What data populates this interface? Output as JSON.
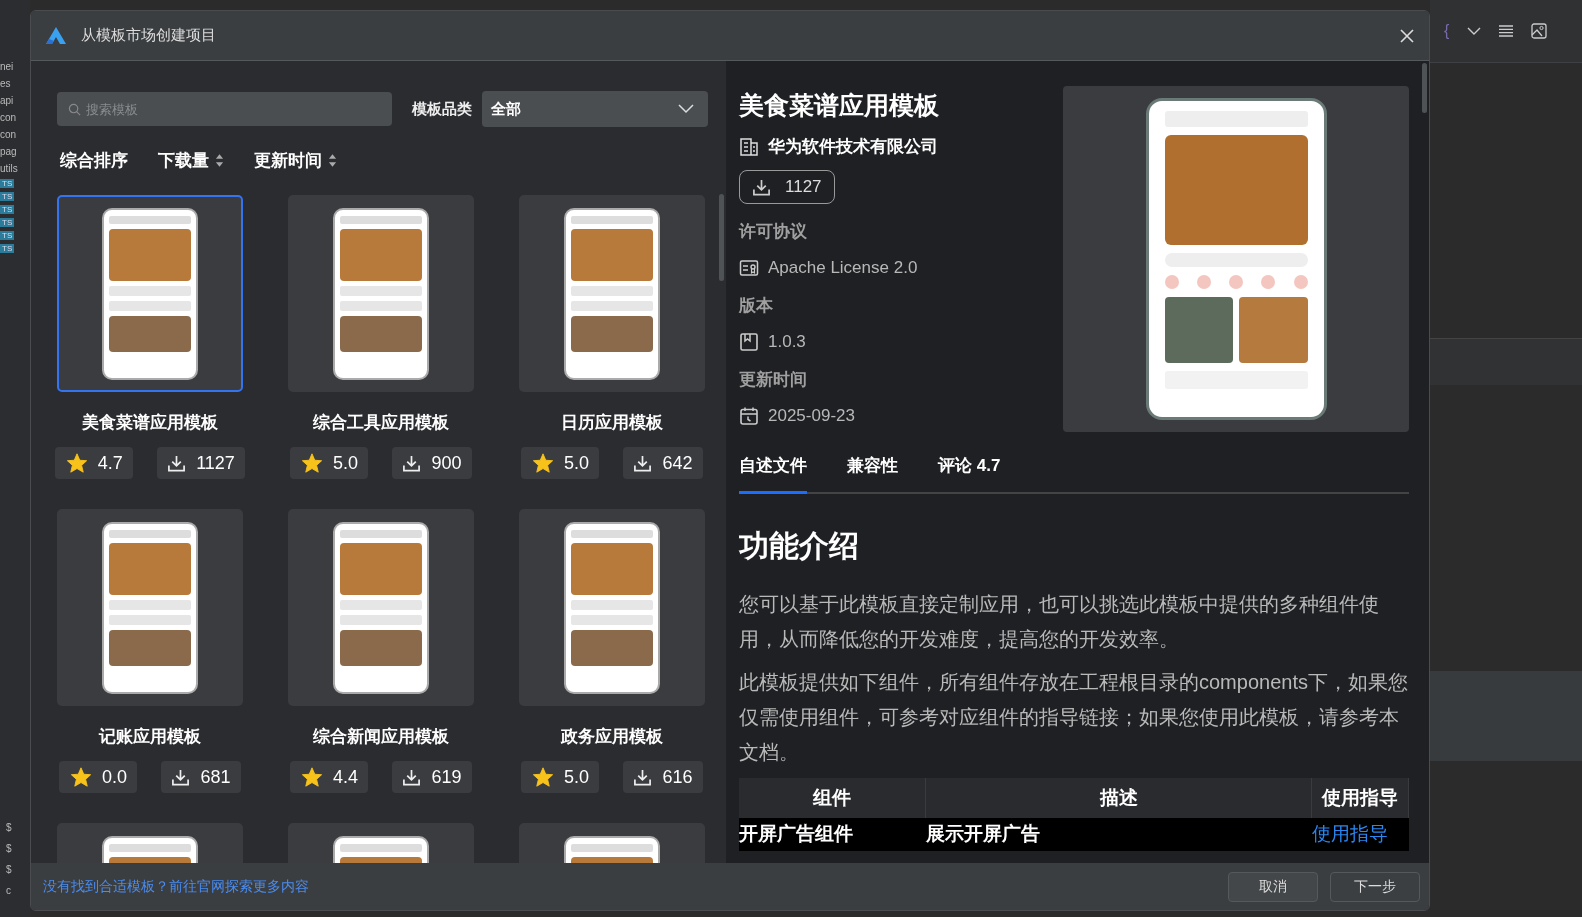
{
  "background_ide": {
    "left_fragments": [
      "nei",
      "es",
      "api",
      "con",
      "con",
      "pag",
      "utils"
    ],
    "file_badges": [
      "TS",
      "TS",
      "TS",
      "TS",
      "TS",
      "TS"
    ],
    "terminal_lines": [
      "$",
      "$",
      "$",
      "c"
    ],
    "toolbar_glyph": "{"
  },
  "window": {
    "title": "从模板市场创建项目"
  },
  "search": {
    "placeholder": "搜索模板"
  },
  "category": {
    "label": "模板品类",
    "value": "全部"
  },
  "sort_options": [
    {
      "label": "综合排序",
      "kind": "plain"
    },
    {
      "label": "下载量",
      "kind": "sortable"
    },
    {
      "label": "更新时间",
      "kind": "sortable"
    }
  ],
  "cards": [
    {
      "title": "美食菜谱应用模板",
      "rating": "4.7",
      "downloads": "1127",
      "selected": true
    },
    {
      "title": "综合工具应用模板",
      "rating": "5.0",
      "downloads": "900",
      "selected": false
    },
    {
      "title": "日历应用模板",
      "rating": "5.0",
      "downloads": "642",
      "selected": false
    },
    {
      "title": "记账应用模板",
      "rating": "0.0",
      "downloads": "681",
      "selected": false
    },
    {
      "title": "综合新闻应用模板",
      "rating": "4.4",
      "downloads": "619",
      "selected": false
    },
    {
      "title": "政务应用模板",
      "rating": "5.0",
      "downloads": "616",
      "selected": false
    },
    {
      "selected": false
    },
    {
      "selected": false
    },
    {
      "selected": false
    }
  ],
  "detail": {
    "title": "美食菜谱应用模板",
    "publisher": "华为软件技术有限公司",
    "downloads": "1127",
    "fields": [
      {
        "label": "许可协议",
        "value": "Apache License 2.0",
        "kind": "license"
      },
      {
        "label": "版本",
        "value": "1.0.3",
        "kind": "version"
      },
      {
        "label": "更新时间",
        "value": "2025-09-23",
        "kind": "date"
      }
    ]
  },
  "tabs": [
    {
      "label": "自述文件",
      "selected": true
    },
    {
      "label": "兼容性",
      "selected": false
    },
    {
      "label": "评论 4.7",
      "selected": false
    }
  ],
  "readme": {
    "heading": "功能介绍",
    "paragraphs": [
      "您可以基于此模板直接定制应用，也可以挑选此模板中提供的多种组件使用，从而降低您的开发难度，提高您的开发效率。",
      "此模板提供如下组件，所有组件存放在工程根目录的components下，如果您仅需使用组件，可参考对应组件的指导链接；如果您使用此模板，请参考本文档。"
    ],
    "table": {
      "columns": [
        "组件",
        "描述",
        "使用指导"
      ],
      "rows": [
        {
          "component": "开屏广告组件",
          "description": "展示开屏广告",
          "guide": "使用指导"
        }
      ]
    }
  },
  "footer": {
    "link": "没有找到合适模板？前往官网探索更多内容",
    "buttons": [
      {
        "label": "取消",
        "kind": "cancel"
      },
      {
        "label": "下一步",
        "kind": "next"
      }
    ]
  }
}
